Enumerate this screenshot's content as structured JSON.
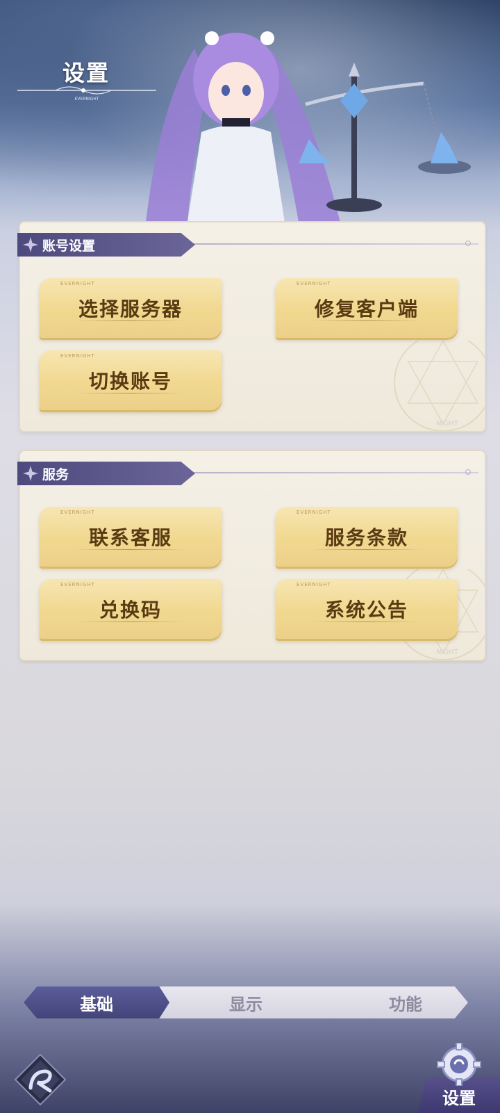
{
  "header": {
    "title": "设置",
    "ornament_text": "EVERNIGHT"
  },
  "sections": {
    "account": {
      "title": "账号设置",
      "buttons": [
        "选择服务器",
        "修复客户端",
        "切换账号"
      ]
    },
    "service": {
      "title": "服务",
      "buttons": [
        "联系客服",
        "服务条款",
        "兑换码",
        "系统公告"
      ]
    }
  },
  "panel_watermark": "NIGHT",
  "tabs": {
    "basic": "基础",
    "display": "显示",
    "function": "功能",
    "active": "基础"
  },
  "bottom_nav": {
    "settings_label": "设置"
  },
  "colors": {
    "tab_active": "#4e4f8a",
    "button_gold": "#f1d88f",
    "button_text": "#5a3a12",
    "section_tab": "#5a5590"
  }
}
